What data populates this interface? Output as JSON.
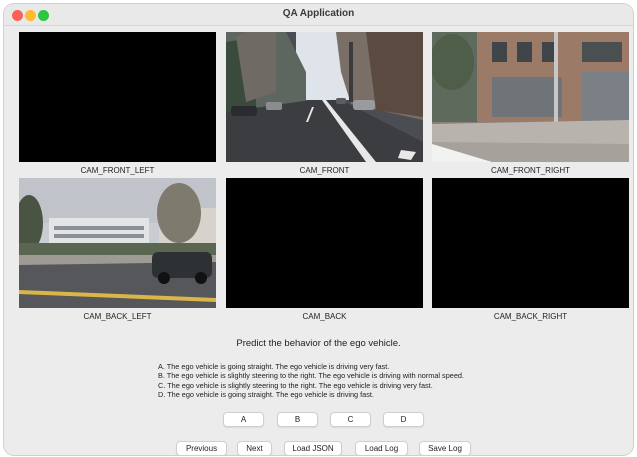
{
  "window": {
    "title": "QA Application"
  },
  "cameras": [
    {
      "label": "CAM_FRONT_LEFT"
    },
    {
      "label": "CAM_FRONT"
    },
    {
      "label": "CAM_FRONT_RIGHT"
    },
    {
      "label": "CAM_BACK_LEFT"
    },
    {
      "label": "CAM_BACK"
    },
    {
      "label": "CAM_BACK_RIGHT"
    }
  ],
  "question": "Predict the behavior of the ego vehicle.",
  "options": [
    "A. The ego vehicle is going straight. The ego vehicle is driving very fast.",
    "B. The ego vehicle is slightly steering to the right. The ego vehicle is driving with normal speed.",
    "C. The ego vehicle is slightly steering to the right. The ego vehicle is driving very fast.",
    "D. The ego vehicle is going straight. The ego vehicle is driving fast."
  ],
  "answer_buttons": [
    "A",
    "B",
    "C",
    "D"
  ],
  "nav_buttons": {
    "previous": "Previous",
    "next": "Next",
    "load_json": "Load JSON",
    "load_log": "Load Log",
    "save_log": "Save Log"
  }
}
